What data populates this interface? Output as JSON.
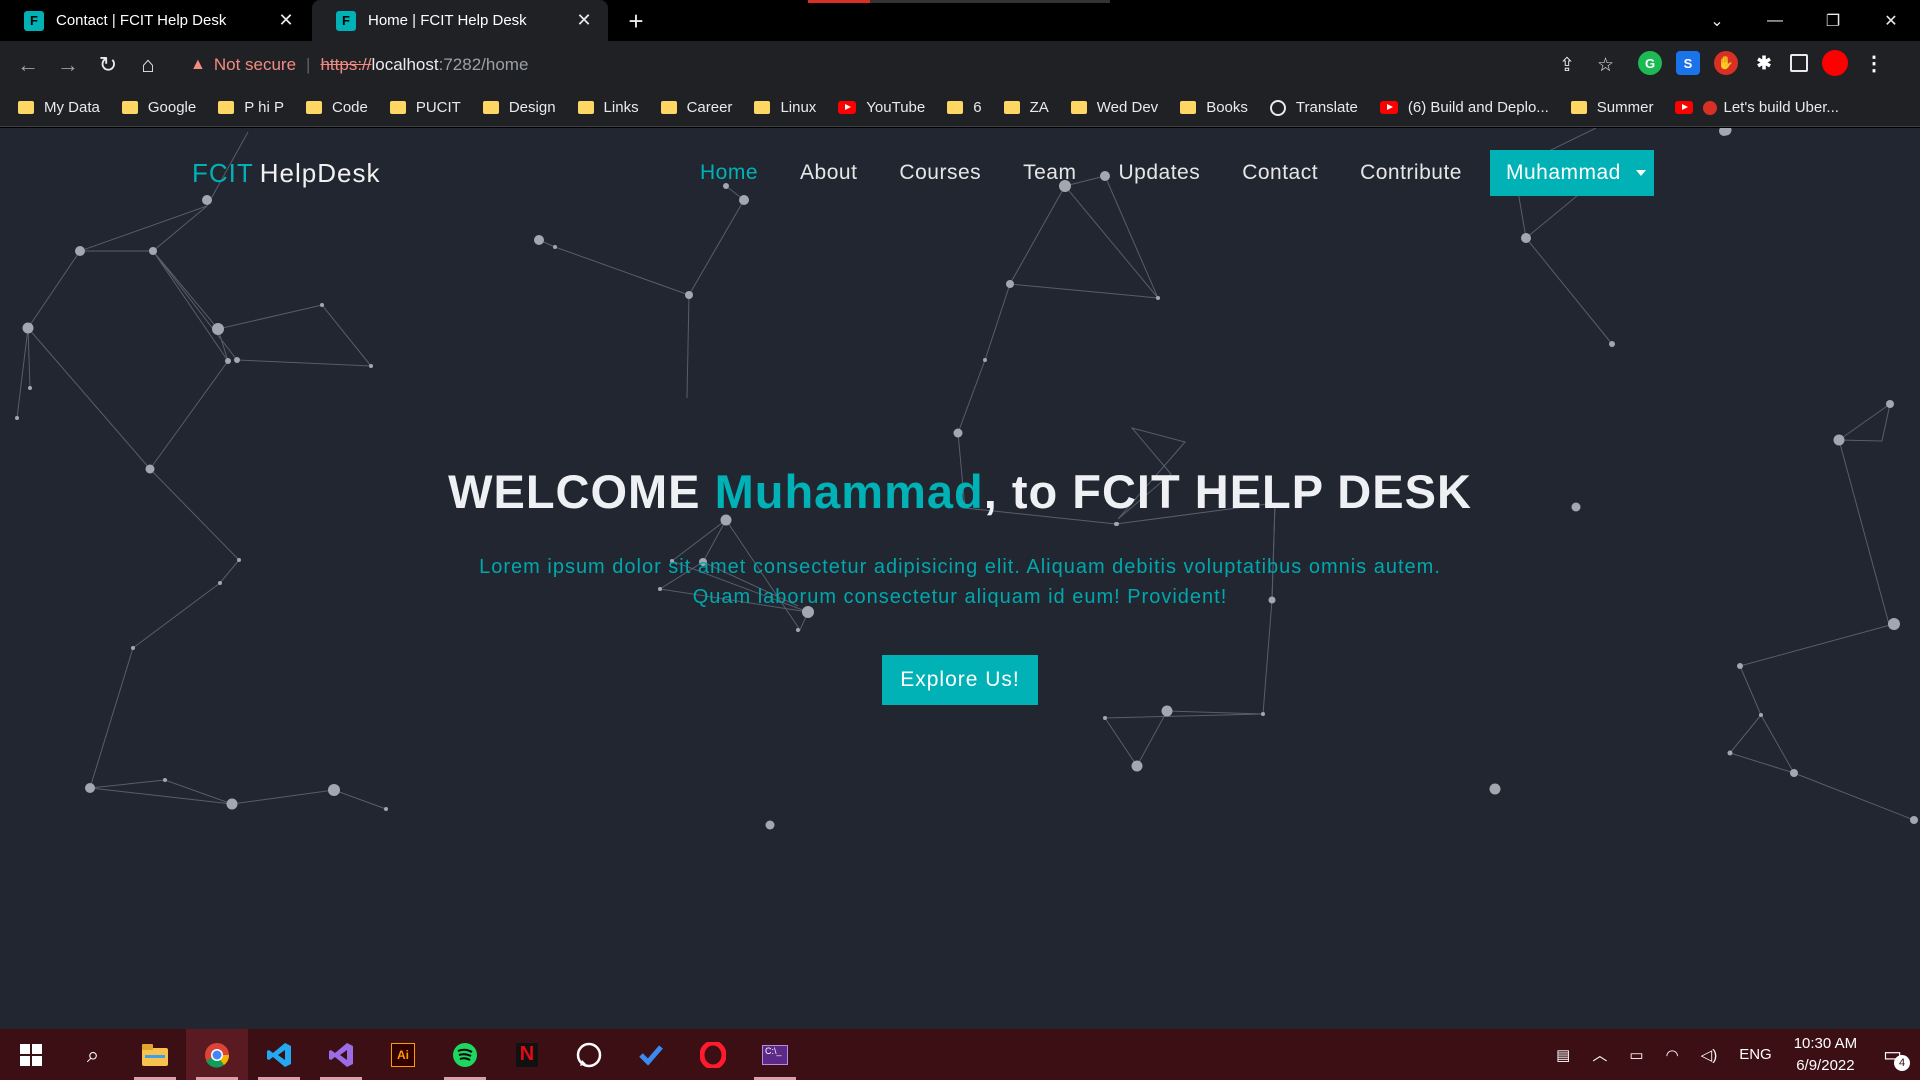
{
  "browser": {
    "tabs": [
      {
        "title": "Contact | FCIT Help Desk",
        "favicon": "F",
        "active": false
      },
      {
        "title": "Home | FCIT Help Desk",
        "favicon": "F",
        "active": true
      }
    ],
    "new_tab_icon": "+",
    "window_controls": [
      "⌄",
      "—",
      "❐",
      "✕"
    ],
    "security_label": "Not secure",
    "url": {
      "scheme": "https://",
      "host": "localhost",
      "rest": ":7282/home"
    },
    "bookmarks": [
      {
        "label": "My Data",
        "icon": "folder-icon"
      },
      {
        "label": "Google",
        "icon": "folder-icon"
      },
      {
        "label": "P hi P",
        "icon": "folder-icon"
      },
      {
        "label": "Code",
        "icon": "folder-icon"
      },
      {
        "label": "PUCIT",
        "icon": "folder-icon"
      },
      {
        "label": "Design",
        "icon": "folder-icon"
      },
      {
        "label": "Links",
        "icon": "folder-icon"
      },
      {
        "label": "Career",
        "icon": "folder-icon"
      },
      {
        "label": "Linux",
        "icon": "folder-icon"
      },
      {
        "label": "YouTube",
        "icon": "youtube-icon"
      },
      {
        "label": "6",
        "icon": "folder-icon"
      },
      {
        "label": "ZA",
        "icon": "folder-icon"
      },
      {
        "label": "Wed Dev",
        "icon": "folder-icon"
      },
      {
        "label": "Books",
        "icon": "folder-icon"
      },
      {
        "label": "Translate",
        "icon": "globe-icon"
      },
      {
        "label": "(6) Build and Deplo...",
        "icon": "youtube-icon"
      },
      {
        "label": "Summer",
        "icon": "folder-icon"
      },
      {
        "label": "Let's build Uber...",
        "icon": "youtube-icon"
      }
    ]
  },
  "site": {
    "brand_accent": "FCIT",
    "brand_rest": "HelpDesk",
    "nav": [
      "Home",
      "About",
      "Courses",
      "Team",
      "Updates",
      "Contact",
      "Contribute"
    ],
    "active_nav": "Home",
    "user_name": "Muhammad",
    "hero": {
      "prefix": "WELCOME ",
      "name": "Muhammad",
      "suffix": ", to FCIT HELP DESK",
      "subtitle": "Lorem ipsum dolor sit amet consectetur adipisicing elit. Aliquam debitis voluptatibus omnis autem. Quam laborum consectetur aliquam id eum! Provident!",
      "button": "Explore Us!"
    },
    "colors": {
      "accent": "#00b2b5",
      "background": "#212631",
      "text": "#eef0f3"
    }
  },
  "taskbar": {
    "apps": [
      "windows-start-icon",
      "search-icon",
      "file-explorer-icon",
      "chrome-icon",
      "vscode-icon",
      "visual-studio-icon",
      "illustrator-icon",
      "spotify-icon",
      "netflix-icon",
      "whatsapp-icon",
      "todo-icon",
      "opera-icon",
      "terminal-icon"
    ],
    "language": "ENG",
    "time": "10:30 AM",
    "date": "6/9/2022",
    "notification_count": "4"
  }
}
